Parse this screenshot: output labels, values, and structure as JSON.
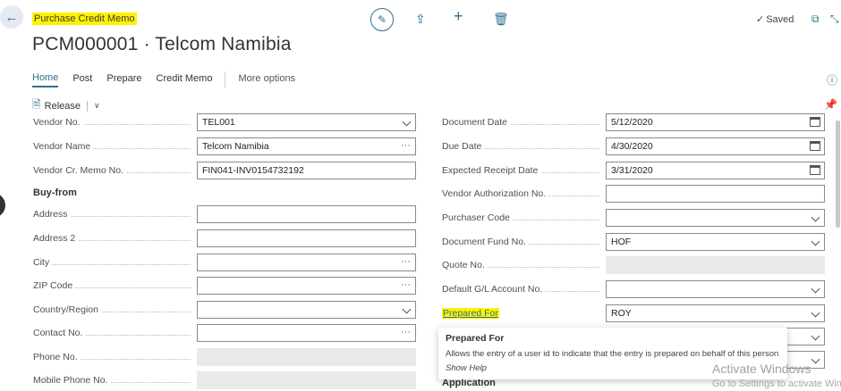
{
  "header": {
    "page_type": "Purchase Credit Memo",
    "record_title": "PCM000001 · Telcom Namibia",
    "saved_label": "Saved"
  },
  "icons": {
    "back": "arrow-left-icon",
    "edit": "pencil-icon",
    "share": "share-icon",
    "new": "plus-icon",
    "delete": "trash-icon",
    "open_new_window": "open-in-new-window-icon",
    "collapse": "collapse-icon"
  },
  "menu": {
    "items": [
      "Home",
      "Post",
      "Prepare",
      "Credit Memo"
    ],
    "more": "More options"
  },
  "actions": {
    "release": "Release"
  },
  "left_fields": [
    {
      "label": "Vendor No.",
      "value": "TEL001",
      "control": "dropdown"
    },
    {
      "label": "Vendor Name",
      "value": "Telcom Namibia",
      "control": "lookup"
    },
    {
      "label": "Vendor Cr. Memo No.",
      "value": "FIN041-INV0154732192",
      "control": "text"
    }
  ],
  "buy_from": {
    "title": "Buy-from",
    "fields": [
      {
        "label": "Address",
        "value": "",
        "control": "text"
      },
      {
        "label": "Address 2",
        "value": "",
        "control": "text"
      },
      {
        "label": "City",
        "value": "",
        "control": "lookup"
      },
      {
        "label": "ZIP Code",
        "value": "",
        "control": "lookup"
      },
      {
        "label": "Country/Region",
        "value": "",
        "control": "dropdown"
      },
      {
        "label": "Contact No.",
        "value": "",
        "control": "lookup"
      },
      {
        "label": "Phone No.",
        "value": "",
        "control": "readonly"
      },
      {
        "label": "Mobile Phone No.",
        "value": "",
        "control": "readonly"
      }
    ]
  },
  "right_fields": [
    {
      "label": "Document Date",
      "value": "5/12/2020",
      "control": "date"
    },
    {
      "label": "Due Date",
      "value": "4/30/2020",
      "control": "date"
    },
    {
      "label": "Expected Receipt Date",
      "value": "3/31/2020",
      "control": "date"
    },
    {
      "label": "Vendor Authorization No.",
      "value": "",
      "control": "text"
    },
    {
      "label": "Purchaser Code",
      "value": "",
      "control": "dropdown"
    },
    {
      "label": "Document Fund No.",
      "value": "HOF",
      "control": "dropdown"
    },
    {
      "label": "Quote No.",
      "value": "",
      "control": "readonly"
    },
    {
      "label": "Default G/L Account No.",
      "value": "",
      "control": "dropdown"
    }
  ],
  "prepared_for": {
    "label": "Prepared For",
    "value": "ROY"
  },
  "application_section": "Application",
  "tooltip": {
    "title": "Prepared For",
    "body": "Allows the entry of a user id to indicate that the entry is prepared on behalf of this person",
    "help": "Show Help"
  },
  "watermark": {
    "line1": "Activate Windows",
    "line2": "Go to Settings to activate Windows."
  },
  "colors": {
    "accent": "#2f6f8f",
    "highlight": "#fff200"
  }
}
